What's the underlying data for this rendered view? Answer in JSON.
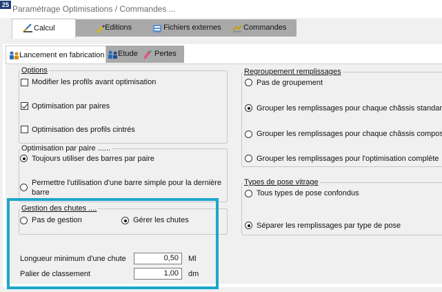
{
  "window": {
    "title": "Paramétrage Optimisations / Commandes ...",
    "app_icon_label": "25"
  },
  "top_tabs": [
    {
      "label": "Calcul",
      "active": true
    },
    {
      "label": "Editions",
      "active": false
    },
    {
      "label": "Fichiers externes",
      "active": false
    },
    {
      "label": "Commandes",
      "active": false
    }
  ],
  "sub_tabs": [
    {
      "label": "Lancement en fabrication",
      "active": true
    },
    {
      "label": "Etude",
      "active": false
    },
    {
      "label": "Pertes",
      "active": false
    }
  ],
  "options": {
    "legend": "Options",
    "items": [
      {
        "label": "Modifier les profils avant optimisation",
        "checked": false
      },
      {
        "label": "Optimisation par paires",
        "checked": true
      },
      {
        "label": "Optimisation des profils cintrés",
        "checked": false
      }
    ]
  },
  "optimisation_par_paire": {
    "legend": "Optimisation par paire ......",
    "items": [
      {
        "label": "Toujours utiliser des barres par paire",
        "selected": true
      },
      {
        "label_line1": "Permettre l'utilisation d'une barre simple pour la dernière",
        "label_line2": "barre",
        "selected": false
      }
    ]
  },
  "gestion_des_chutes": {
    "legend": "Gestion des chutes ....",
    "items": [
      {
        "label": "Pas de gestion",
        "selected": false
      },
      {
        "label": "Gérer les chutes",
        "selected": true
      }
    ]
  },
  "chute_fields": [
    {
      "label": "Longueur minimum d'une chute",
      "value": "0,50",
      "unit": "Ml"
    },
    {
      "label": "Palier de classement",
      "value": "1,00",
      "unit": "dm"
    }
  ],
  "regroupement": {
    "legend": "Regroupement remplissages",
    "items": [
      {
        "label": "Pas de groupement",
        "selected": false
      },
      {
        "label": "Grouper les remplissages pour chaque châssis standard",
        "selected": true
      },
      {
        "label": "Grouper les remplissages pour chaque châssis composé",
        "selected": false
      },
      {
        "label": "Grouper les remplissages pour l'optimisation complète",
        "selected": false
      }
    ]
  },
  "types_de_pose": {
    "legend": "Types de pose vitrage",
    "items": [
      {
        "label": "Tous types de pose confondus",
        "selected": false
      },
      {
        "label": "Séparer les remplissages par type de pose",
        "selected": true
      }
    ]
  },
  "colors": {
    "highlight": "#1ea6cc",
    "tab_strip": "#a9a9a9",
    "panel": "#f0f0f0"
  }
}
